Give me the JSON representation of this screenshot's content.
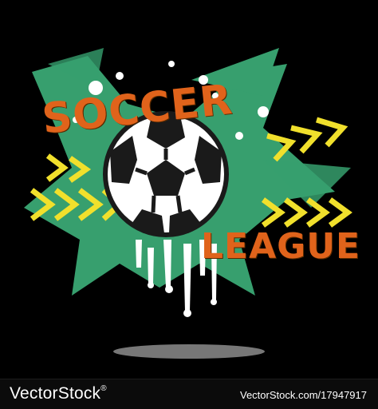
{
  "poster": {
    "title_top": "SOCCER",
    "title_bottom": "LEAGUE",
    "colors": {
      "background": "#000000",
      "splash_green": "#3aa874",
      "title_orange": "#e0631b",
      "arrow_yellow": "#f1e02c",
      "ball_black": "#1a1a1a",
      "ball_white": "#ffffff"
    },
    "icons": [
      "soccer-ball-icon",
      "chevron-arrow-icon"
    ]
  },
  "footer": {
    "brand": "VectorStock",
    "reg_mark": "®",
    "image_ref": "VectorStock.com/17947917"
  }
}
